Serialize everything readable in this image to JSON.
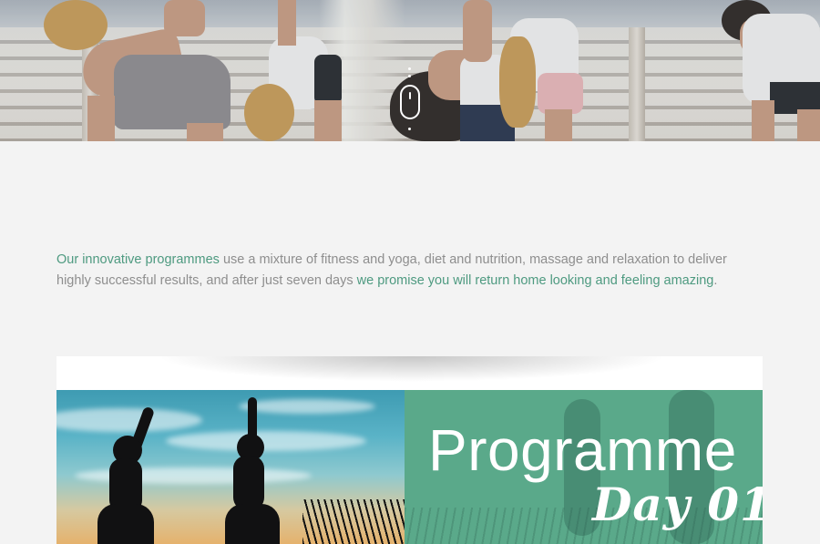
{
  "hero": {
    "image": "yoga-class-stretching-photo",
    "scroll_icon": "mouse-scroll-icon"
  },
  "intro": {
    "lead_accent": "Our innovative programmes",
    "body_1": " use a mixture of fitness and yoga, diet and nutrition, massage and relaxation to deliver highly successful results, and after just seven days ",
    "closing_accent": "we promise you will return home looking and feeling amazing",
    "end": "."
  },
  "programme_card": {
    "image": "yoga-silhouettes-sunset-photo",
    "title": "Programme",
    "day": "Day 01",
    "panel_color": "#5aa98a"
  },
  "colors": {
    "accent": "#4e9a80",
    "body_text": "#8e8e8e",
    "background": "#f3f3f3"
  }
}
